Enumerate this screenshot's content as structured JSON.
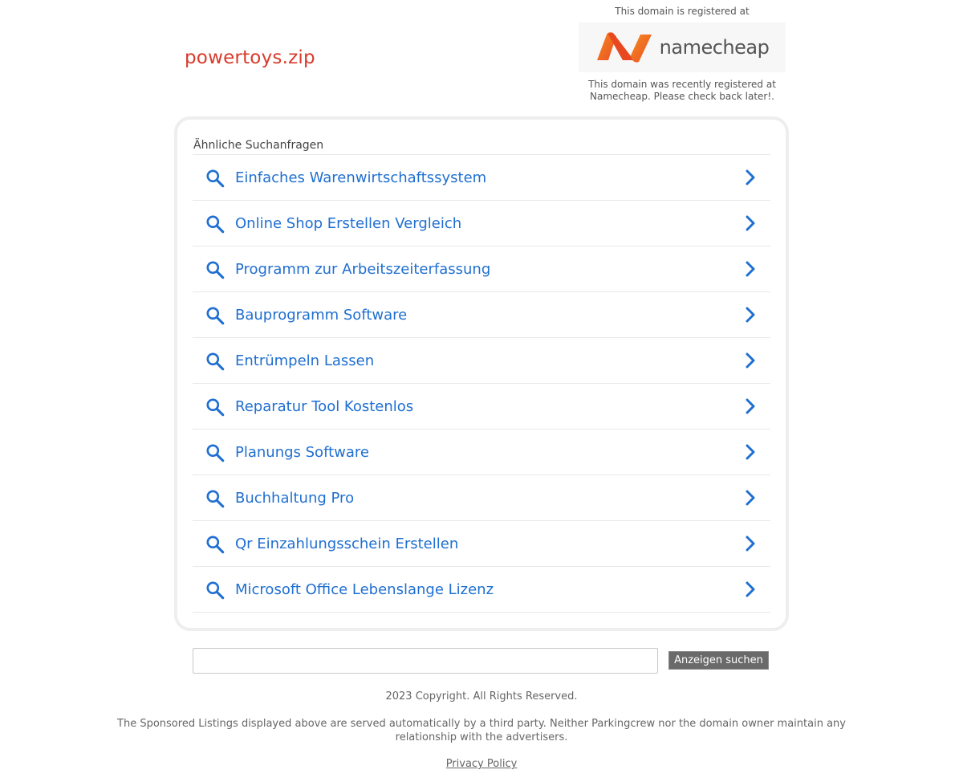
{
  "header": {
    "domain": "powertoys.zip",
    "registrar_top_note": "This domain is registered at",
    "registrar_logo_text": "namecheap",
    "registrar_bottom_note": "This domain was recently registered at Namecheap. Please check back later!."
  },
  "related": {
    "heading": "Ähnliche Suchanfragen",
    "items": [
      {
        "label": "Einfaches Warenwirtschaftssystem"
      },
      {
        "label": "Online Shop Erstellen Vergleich"
      },
      {
        "label": "Programm zur Arbeitszeiterfassung"
      },
      {
        "label": "Bauprogramm Software"
      },
      {
        "label": "Entrümpeln Lassen"
      },
      {
        "label": "Reparatur Tool Kostenlos"
      },
      {
        "label": "Planungs Software"
      },
      {
        "label": "Buchhaltung Pro"
      },
      {
        "label": "Qr Einzahlungsschein Erstellen"
      },
      {
        "label": "Microsoft Office Lebenslange Lizenz"
      }
    ],
    "item_icon": "search-icon",
    "item_arrow_icon": "chevron-right-icon",
    "link_color": "#1f6fd1"
  },
  "search": {
    "value": "",
    "button_label": "Anzeigen suchen"
  },
  "footer": {
    "copyright": "2023 Copyright. All Rights Reserved.",
    "disclaimer": "The Sponsored Listings displayed above are served automatically by a third party. Neither Parkingcrew nor the domain owner maintain any relationship with the advertisers.",
    "privacy_label": "Privacy Policy"
  },
  "colors": {
    "domain_title": "#d93b2b",
    "brand_orange": "#f26b21"
  }
}
